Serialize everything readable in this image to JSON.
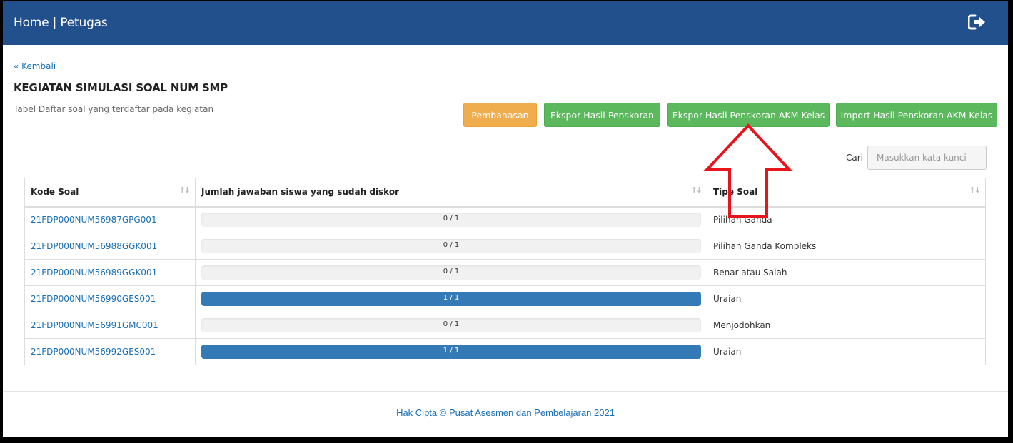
{
  "navbar": {
    "title": "Home | Petugas",
    "logout_icon": "sign-out-icon"
  },
  "back_link": "« Kembali",
  "page_title": "KEGIATAN SIMULASI SOAL NUM SMP",
  "subtitle": "Tabel Daftar soal yang terdaftar pada kegiatan",
  "buttons": {
    "pembahasan": "Pembahasan",
    "ekspor": "Ekspor Hasil Penskoran",
    "ekspor_akm": "Ekspor Hasil Penskoran AKM Kelas",
    "import_akm": "Import Hasil Penskoran AKM Kelas"
  },
  "colors": {
    "navbar": "#22508d",
    "warning": "#f0ad4e",
    "success": "#5cb85c",
    "progress": "#337ab7",
    "annotation_arrow": "#e8141b"
  },
  "search": {
    "label": "Cari",
    "placeholder": "Masukkan kata kunci"
  },
  "table": {
    "headers": [
      "Kode Soal",
      "Jumlah jawaban siswa yang sudah diskor",
      "Tipe Soal"
    ],
    "rows": [
      {
        "code": "21FDP000NUM56987GPG001",
        "progress_text": "0 / 1",
        "progress": 0,
        "type": "Pilihan Ganda"
      },
      {
        "code": "21FDP000NUM56988GGK001",
        "progress_text": "0 / 1",
        "progress": 0,
        "type": "Pilihan Ganda Kompleks"
      },
      {
        "code": "21FDP000NUM56989GGK001",
        "progress_text": "0 / 1",
        "progress": 0,
        "type": "Benar atau Salah"
      },
      {
        "code": "21FDP000NUM56990GES001",
        "progress_text": "1 / 1",
        "progress": 1,
        "type": "Uraian"
      },
      {
        "code": "21FDP000NUM56991GMC001",
        "progress_text": "0 / 1",
        "progress": 0,
        "type": "Menjodohkan"
      },
      {
        "code": "21FDP000NUM56992GES001",
        "progress_text": "1 / 1",
        "progress": 1,
        "type": "Uraian"
      }
    ]
  },
  "footer": "Hak Cipta © Pusat Asesmen dan Pembelajaran 2021"
}
